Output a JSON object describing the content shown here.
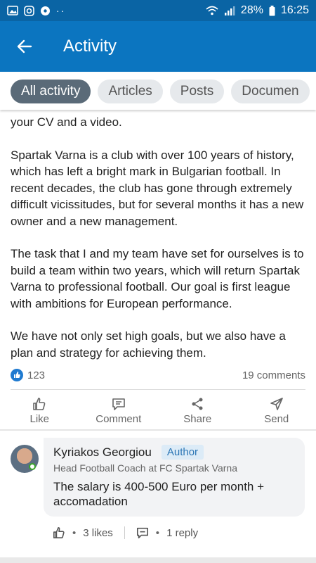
{
  "status_bar": {
    "battery": "28%",
    "time": "16:25"
  },
  "app_bar": {
    "title": "Activity"
  },
  "tabs": [
    {
      "label": "All activity",
      "active": true
    },
    {
      "label": "Articles",
      "active": false
    },
    {
      "label": "Posts",
      "active": false
    },
    {
      "label": "Documen",
      "active": false
    }
  ],
  "post": {
    "paragraphs": [
      "your CV and a video.",
      "Spartak Varna is a club with over 100 years of history, which has left a bright mark in Bulgarian football.  In recent decades, the club has gone through extremely difficult vicissitudes, but for several months it has a new owner and a new management.",
      "The task that I and my team have set for ourselves is to build a team within two years, which will return Spartak Varna to professional football.  Our goal is first league with ambitions for European performance.",
      "We have not only set high goals, but we also have a plan and strategy for achieving them."
    ],
    "reactions": "123",
    "comments_count": "19 comments"
  },
  "actions": {
    "like": "Like",
    "comment": "Comment",
    "share": "Share",
    "send": "Send"
  },
  "comment": {
    "author": "Kyriakos Georgiou",
    "badge": "Author",
    "headline": "Head Football Coach at FC Spartak Varna",
    "text": "The salary is 400-500 Euro per month + accomadation",
    "likes": "3 likes",
    "replies": "1 reply",
    "bullet": "•"
  },
  "colors": {
    "brand": "#0b75c0",
    "status_bar": "#0a64a4",
    "active_tab": "#5a6a78"
  }
}
